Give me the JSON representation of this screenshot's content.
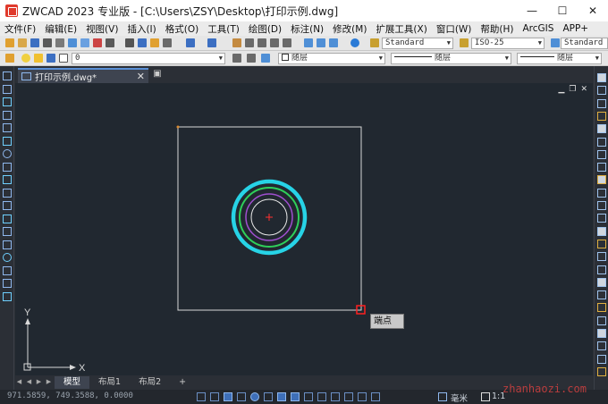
{
  "titlebar": {
    "title": "ZWCAD 2023 专业版 - [C:\\Users\\ZSY\\Desktop\\打印示例.dwg]",
    "minimize": "—",
    "maximize": "☐",
    "close": "✕"
  },
  "menubar": {
    "items": [
      "文件(F)",
      "编辑(E)",
      "视图(V)",
      "插入(I)",
      "格式(O)",
      "工具(T)",
      "绘图(D)",
      "标注(N)",
      "修改(M)",
      "扩展工具(X)",
      "窗口(W)",
      "帮助(H)",
      "ArcGIS",
      "APP+"
    ]
  },
  "toolbar": {
    "text_style": "Standard",
    "dim_style": "ISO-25",
    "table_style": "Standard",
    "layer": "0",
    "color": "随层",
    "linetype": "随层",
    "lineweight": "随层"
  },
  "document": {
    "tab_label": "打印示例.dwg*",
    "tab_close": "✕"
  },
  "canvas": {
    "bg_color": "#212830",
    "tooltip": "端点",
    "ucs_x": "X",
    "ucs_y": "Y"
  },
  "layout_tabs": [
    "模型",
    "布局1",
    "布局2",
    "+"
  ],
  "status": {
    "coordinates": "971.5859, 749.3588, 0.0000",
    "unit": "毫米",
    "scale": "1:1"
  },
  "watermark": "zhanhaozi.com",
  "colors": {
    "accent": "#5a8fd6",
    "cyan_circle": "#27d3e6",
    "green_circle": "#2fd05a",
    "magenta_circle": "#a04fd0",
    "white_circle": "#e8e8e8",
    "snap_marker": "#ff2020"
  }
}
